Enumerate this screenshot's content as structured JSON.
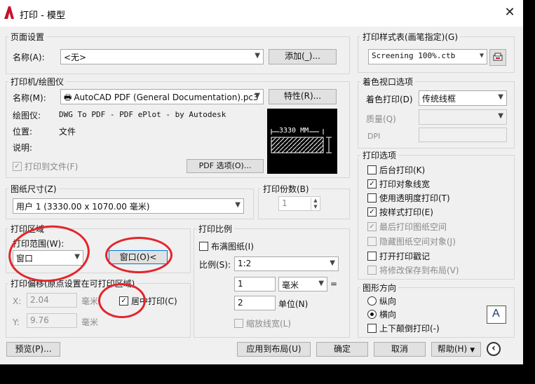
{
  "window": {
    "title": "打印 - 模型",
    "close_glyph": "✕"
  },
  "page_setup": {
    "group": "页面设置",
    "name_label": "名称(A):",
    "name_value": "<无>",
    "add_button": "添加(_)..."
  },
  "printer": {
    "group": "打印机/绘图仪",
    "name_label": "名称(M):",
    "name_value": "AutoCAD PDF (General Documentation).pc3",
    "properties_button": "特性(R)...",
    "plotter_label": "绘图仪:",
    "plotter_value": "DWG To PDF - PDF ePlot - by Autodesk",
    "location_label": "位置:",
    "location_value": "文件",
    "desc_label": "说明:",
    "plot_to_file": "打印到文件(F)",
    "pdf_options_button": "PDF 选项(O)...",
    "preview_dim": "3330 MM"
  },
  "paper_size": {
    "group": "图纸尺寸(Z)",
    "value": "用户 1 (3330.00 x 1070.00 毫米)"
  },
  "copies": {
    "group": "打印份数(B)",
    "value": "1"
  },
  "plot_area": {
    "group": "打印区域",
    "range_label": "打印范围(W):",
    "range_value": "窗口",
    "window_button": "窗口(O)<"
  },
  "plot_offset": {
    "group": "打印偏移(原点设置在可打印区域)",
    "x_label": "X:",
    "x_value": "2.04",
    "x_unit": "毫米",
    "y_label": "Y:",
    "y_value": "9.76",
    "y_unit": "毫米",
    "center_label": "居中打印(C)"
  },
  "plot_scale": {
    "group": "打印比例",
    "fit_label": "布满图纸(I)",
    "scale_label": "比例(S):",
    "scale_value": "1:2",
    "num_value": "1",
    "unit_value": "毫米",
    "eq": "=",
    "den_value": "2",
    "unit_label": "单位(N)",
    "lineweight_label": "缩放线宽(L)"
  },
  "style_table": {
    "group": "打印样式表(画笔指定)(G)",
    "value": "Screening 100%.ctb"
  },
  "shaded": {
    "group": "着色视口选项",
    "shade_label": "着色打印(D)",
    "shade_value": "传统线框",
    "quality_label": "质量(Q)",
    "dpi_label": "DPI"
  },
  "options": {
    "group": "打印选项",
    "items": [
      {
        "label": "后台打印(K)",
        "checked": false
      },
      {
        "label": "打印对象线宽",
        "checked": true
      },
      {
        "label": "使用透明度打印(T)",
        "checked": false
      },
      {
        "label": "按样式打印(E)",
        "checked": true
      },
      {
        "label": "最后打印图纸空间",
        "checked": true
      },
      {
        "label": "隐藏图纸空间对象(J)",
        "checked": false
      },
      {
        "label": "打开打印戳记",
        "checked": false
      },
      {
        "label": "将修改保存到布局(V)",
        "checked": false
      }
    ]
  },
  "orientation": {
    "group": "图形方向",
    "portrait": "纵向",
    "landscape": "横向",
    "upside_down": "上下颠倒打印(-)",
    "icon_letter": "A"
  },
  "footer": {
    "preview": "预览(P)...",
    "apply": "应用到布局(U)",
    "ok": "确定",
    "cancel": "取消",
    "help": "帮助(H)",
    "collapse_glyph": "‹"
  },
  "colors": {
    "annotation_red": "#e3252b",
    "dialog_bg": "#f0f0f0"
  }
}
